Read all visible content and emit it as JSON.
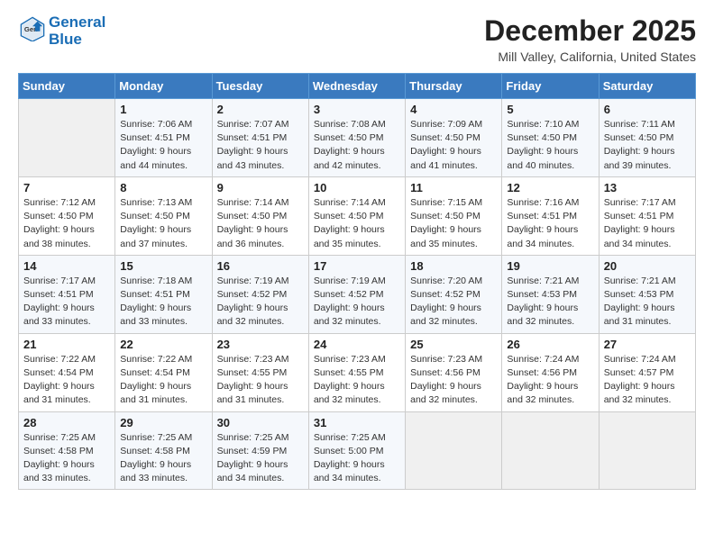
{
  "header": {
    "logo_line1": "General",
    "logo_line2": "Blue",
    "month": "December 2025",
    "location": "Mill Valley, California, United States"
  },
  "days_of_week": [
    "Sunday",
    "Monday",
    "Tuesday",
    "Wednesday",
    "Thursday",
    "Friday",
    "Saturday"
  ],
  "weeks": [
    [
      {
        "day": "",
        "info": ""
      },
      {
        "day": "1",
        "info": "Sunrise: 7:06 AM\nSunset: 4:51 PM\nDaylight: 9 hours\nand 44 minutes."
      },
      {
        "day": "2",
        "info": "Sunrise: 7:07 AM\nSunset: 4:51 PM\nDaylight: 9 hours\nand 43 minutes."
      },
      {
        "day": "3",
        "info": "Sunrise: 7:08 AM\nSunset: 4:50 PM\nDaylight: 9 hours\nand 42 minutes."
      },
      {
        "day": "4",
        "info": "Sunrise: 7:09 AM\nSunset: 4:50 PM\nDaylight: 9 hours\nand 41 minutes."
      },
      {
        "day": "5",
        "info": "Sunrise: 7:10 AM\nSunset: 4:50 PM\nDaylight: 9 hours\nand 40 minutes."
      },
      {
        "day": "6",
        "info": "Sunrise: 7:11 AM\nSunset: 4:50 PM\nDaylight: 9 hours\nand 39 minutes."
      }
    ],
    [
      {
        "day": "7",
        "info": "Sunrise: 7:12 AM\nSunset: 4:50 PM\nDaylight: 9 hours\nand 38 minutes."
      },
      {
        "day": "8",
        "info": "Sunrise: 7:13 AM\nSunset: 4:50 PM\nDaylight: 9 hours\nand 37 minutes."
      },
      {
        "day": "9",
        "info": "Sunrise: 7:14 AM\nSunset: 4:50 PM\nDaylight: 9 hours\nand 36 minutes."
      },
      {
        "day": "10",
        "info": "Sunrise: 7:14 AM\nSunset: 4:50 PM\nDaylight: 9 hours\nand 35 minutes."
      },
      {
        "day": "11",
        "info": "Sunrise: 7:15 AM\nSunset: 4:50 PM\nDaylight: 9 hours\nand 35 minutes."
      },
      {
        "day": "12",
        "info": "Sunrise: 7:16 AM\nSunset: 4:51 PM\nDaylight: 9 hours\nand 34 minutes."
      },
      {
        "day": "13",
        "info": "Sunrise: 7:17 AM\nSunset: 4:51 PM\nDaylight: 9 hours\nand 34 minutes."
      }
    ],
    [
      {
        "day": "14",
        "info": "Sunrise: 7:17 AM\nSunset: 4:51 PM\nDaylight: 9 hours\nand 33 minutes."
      },
      {
        "day": "15",
        "info": "Sunrise: 7:18 AM\nSunset: 4:51 PM\nDaylight: 9 hours\nand 33 minutes."
      },
      {
        "day": "16",
        "info": "Sunrise: 7:19 AM\nSunset: 4:52 PM\nDaylight: 9 hours\nand 32 minutes."
      },
      {
        "day": "17",
        "info": "Sunrise: 7:19 AM\nSunset: 4:52 PM\nDaylight: 9 hours\nand 32 minutes."
      },
      {
        "day": "18",
        "info": "Sunrise: 7:20 AM\nSunset: 4:52 PM\nDaylight: 9 hours\nand 32 minutes."
      },
      {
        "day": "19",
        "info": "Sunrise: 7:21 AM\nSunset: 4:53 PM\nDaylight: 9 hours\nand 32 minutes."
      },
      {
        "day": "20",
        "info": "Sunrise: 7:21 AM\nSunset: 4:53 PM\nDaylight: 9 hours\nand 31 minutes."
      }
    ],
    [
      {
        "day": "21",
        "info": "Sunrise: 7:22 AM\nSunset: 4:54 PM\nDaylight: 9 hours\nand 31 minutes."
      },
      {
        "day": "22",
        "info": "Sunrise: 7:22 AM\nSunset: 4:54 PM\nDaylight: 9 hours\nand 31 minutes."
      },
      {
        "day": "23",
        "info": "Sunrise: 7:23 AM\nSunset: 4:55 PM\nDaylight: 9 hours\nand 31 minutes."
      },
      {
        "day": "24",
        "info": "Sunrise: 7:23 AM\nSunset: 4:55 PM\nDaylight: 9 hours\nand 32 minutes."
      },
      {
        "day": "25",
        "info": "Sunrise: 7:23 AM\nSunset: 4:56 PM\nDaylight: 9 hours\nand 32 minutes."
      },
      {
        "day": "26",
        "info": "Sunrise: 7:24 AM\nSunset: 4:56 PM\nDaylight: 9 hours\nand 32 minutes."
      },
      {
        "day": "27",
        "info": "Sunrise: 7:24 AM\nSunset: 4:57 PM\nDaylight: 9 hours\nand 32 minutes."
      }
    ],
    [
      {
        "day": "28",
        "info": "Sunrise: 7:25 AM\nSunset: 4:58 PM\nDaylight: 9 hours\nand 33 minutes."
      },
      {
        "day": "29",
        "info": "Sunrise: 7:25 AM\nSunset: 4:58 PM\nDaylight: 9 hours\nand 33 minutes."
      },
      {
        "day": "30",
        "info": "Sunrise: 7:25 AM\nSunset: 4:59 PM\nDaylight: 9 hours\nand 34 minutes."
      },
      {
        "day": "31",
        "info": "Sunrise: 7:25 AM\nSunset: 5:00 PM\nDaylight: 9 hours\nand 34 minutes."
      },
      {
        "day": "",
        "info": ""
      },
      {
        "day": "",
        "info": ""
      },
      {
        "day": "",
        "info": ""
      }
    ]
  ]
}
